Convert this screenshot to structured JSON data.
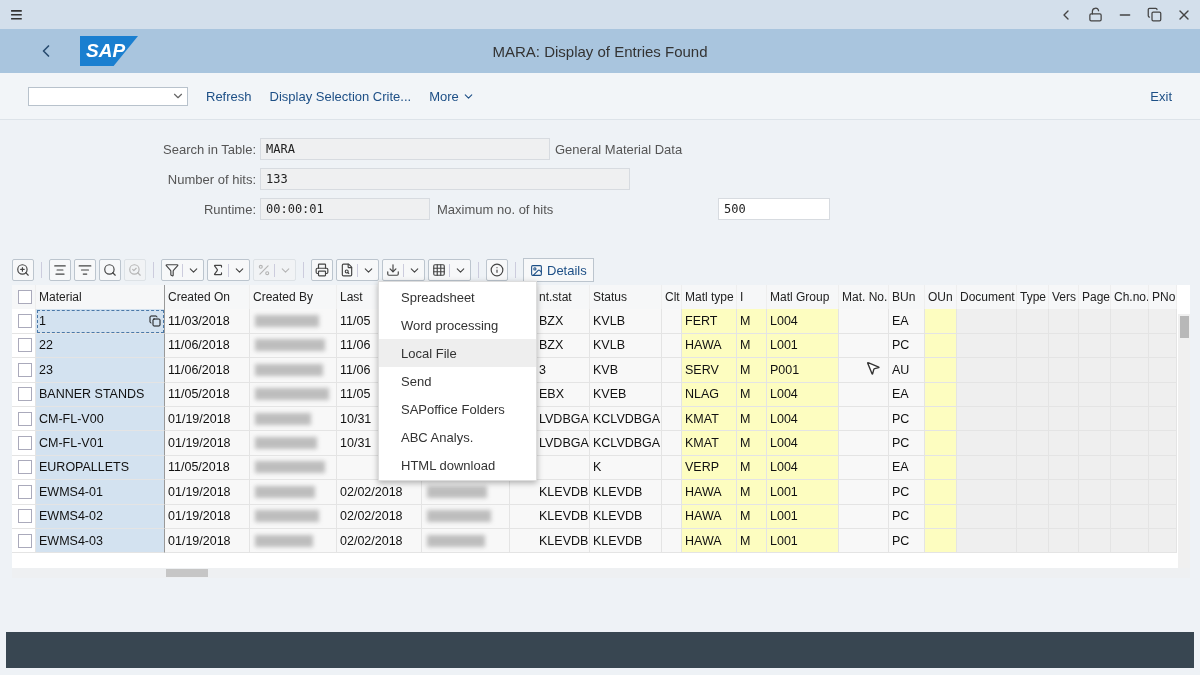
{
  "topbar": {
    "menu": "≡"
  },
  "titlebar": {
    "logo": "SAP",
    "title": "MARA: Display of Entries Found"
  },
  "actions": {
    "items": [
      "Refresh",
      "Display Selection Crite...",
      "More"
    ],
    "exit": "Exit"
  },
  "form": {
    "search_label": "Search in Table:",
    "search_value": "MARA",
    "search_desc": "General Material Data",
    "hits_label": "Number of hits:",
    "hits_value": "133",
    "runtime_label": "Runtime:",
    "runtime_value": "00:00:01",
    "max_label": "Maximum no. of hits",
    "max_value": "500"
  },
  "toolbar": {
    "buttons": [
      {
        "disabled": false,
        "dropdown": false
      },
      {
        "disabled": false,
        "dropdown": false
      },
      {
        "disabled": false,
        "dropdown": false
      },
      {
        "disabled": false,
        "dropdown": false
      },
      {
        "disabled": true,
        "dropdown": false
      },
      {
        "disabled": false,
        "dropdown": true
      },
      {
        "disabled": false,
        "dropdown": true
      },
      {
        "disabled": true,
        "dropdown": true
      },
      {
        "disabled": false,
        "dropdown": false
      },
      {
        "disabled": false,
        "dropdown": true
      },
      {
        "disabled": false,
        "dropdown": true
      },
      {
        "disabled": false,
        "dropdown": true
      },
      {
        "disabled": false,
        "dropdown": false
      }
    ],
    "details": "Details"
  },
  "table": {
    "select_all": {
      "checked": false
    },
    "columns": [
      {
        "label": "Material",
        "color": "#d3e2f0"
      },
      {
        "label": "Created On"
      },
      {
        "label": "Created By",
        "kind": "redacted"
      },
      {
        "label": "Last"
      },
      {
        "kind": "redacted"
      },
      {
        "label": "nt.stat"
      },
      {
        "label": "Status"
      },
      {
        "label": "Clt"
      },
      {
        "label": "Matl type",
        "color": "#fdfdc0"
      },
      {
        "label": "I",
        "color": "#fdfdc0"
      },
      {
        "label": "Matl Group",
        "color": "#fdfdc0"
      },
      {
        "label": "Mat. No."
      },
      {
        "label": "BUn"
      },
      {
        "label": "OUn",
        "color": "#fdfdc0"
      },
      {
        "label": "Document"
      },
      {
        "label": "Type"
      },
      {
        "label": "Vers"
      },
      {
        "label": "Page"
      },
      {
        "label": "Ch.no."
      },
      {
        "label": "PNo"
      }
    ],
    "rows": [
      {
        "selected": false,
        "focused": true,
        "cells": [
          "1",
          "11/03/2018",
          null,
          "11/05",
          null,
          "BZX",
          "KVLB",
          null,
          "FERT",
          "M",
          "L004",
          null,
          "EA",
          null,
          null,
          null,
          null,
          null,
          null,
          null
        ]
      },
      {
        "selected": false,
        "focused": false,
        "cells": [
          "22",
          "11/06/2018",
          null,
          "11/06",
          null,
          "BZX",
          "KVLB",
          null,
          "HAWA",
          "M",
          "L001",
          null,
          "PC",
          null,
          null,
          null,
          null,
          null,
          null,
          null
        ]
      },
      {
        "selected": false,
        "focused": false,
        "cells": [
          "23",
          "11/06/2018",
          null,
          "11/06",
          null,
          "3",
          "KVB",
          null,
          "SERV",
          "M",
          "P001",
          null,
          "AU",
          null,
          null,
          null,
          null,
          null,
          null,
          null
        ]
      },
      {
        "selected": false,
        "focused": false,
        "cells": [
          "BANNER STANDS",
          "11/05/2018",
          null,
          "11/05",
          null,
          "EBX",
          "KVEB",
          null,
          "NLAG",
          "M",
          "L004",
          null,
          "EA",
          null,
          null,
          null,
          null,
          null,
          null,
          null
        ]
      },
      {
        "selected": false,
        "focused": false,
        "cells": [
          "CM-FL-V00",
          "01/19/2018",
          null,
          "10/31",
          null,
          "LVDBGA",
          "KCLVDBGA",
          null,
          "KMAT",
          "M",
          "L004",
          null,
          "PC",
          null,
          null,
          null,
          null,
          null,
          null,
          null
        ]
      },
      {
        "selected": false,
        "focused": false,
        "cells": [
          "CM-FL-V01",
          "01/19/2018",
          null,
          "10/31",
          null,
          "LVDBGA",
          "KCLVDBGA",
          null,
          "KMAT",
          "M",
          "L004",
          null,
          "PC",
          null,
          null,
          null,
          null,
          null,
          null,
          null
        ]
      },
      {
        "selected": false,
        "focused": false,
        "cells": [
          "EUROPALLETS",
          "11/05/2018",
          null,
          null,
          null,
          null,
          "K",
          null,
          "VERP",
          "M",
          "L004",
          null,
          "EA",
          null,
          null,
          null,
          null,
          null,
          null,
          null
        ]
      },
      {
        "selected": false,
        "focused": false,
        "cells": [
          "EWMS4-01",
          "01/19/2018",
          null,
          "02/02/2018",
          null,
          "KLEVDB",
          "KLEVDB",
          null,
          "HAWA",
          "M",
          "L001",
          null,
          "PC",
          null,
          null,
          null,
          null,
          null,
          null,
          null
        ]
      },
      {
        "selected": false,
        "focused": false,
        "cells": [
          "EWMS4-02",
          "01/19/2018",
          null,
          "02/02/2018",
          null,
          "KLEVDB",
          "KLEVDB",
          null,
          "HAWA",
          "M",
          "L001",
          null,
          "PC",
          null,
          null,
          null,
          null,
          null,
          null,
          null
        ]
      },
      {
        "selected": false,
        "focused": false,
        "cells": [
          "EWMS4-03",
          "01/19/2018",
          null,
          "02/02/2018",
          null,
          "KLEVDB",
          "KLEVDB",
          null,
          "HAWA",
          "M",
          "L001",
          null,
          "PC",
          null,
          null,
          null,
          null,
          null,
          null,
          null
        ]
      }
    ]
  },
  "export_menu": {
    "items": [
      {
        "label": "Spreadsheet",
        "selected": false
      },
      {
        "label": "Word processing",
        "selected": false
      },
      {
        "label": "Local File",
        "selected": true
      },
      {
        "label": "Send",
        "selected": false
      },
      {
        "label": "SAPoffice Folders",
        "selected": false
      },
      {
        "label": "ABC Analys.",
        "selected": false
      },
      {
        "label": "HTML download",
        "selected": false
      }
    ]
  }
}
